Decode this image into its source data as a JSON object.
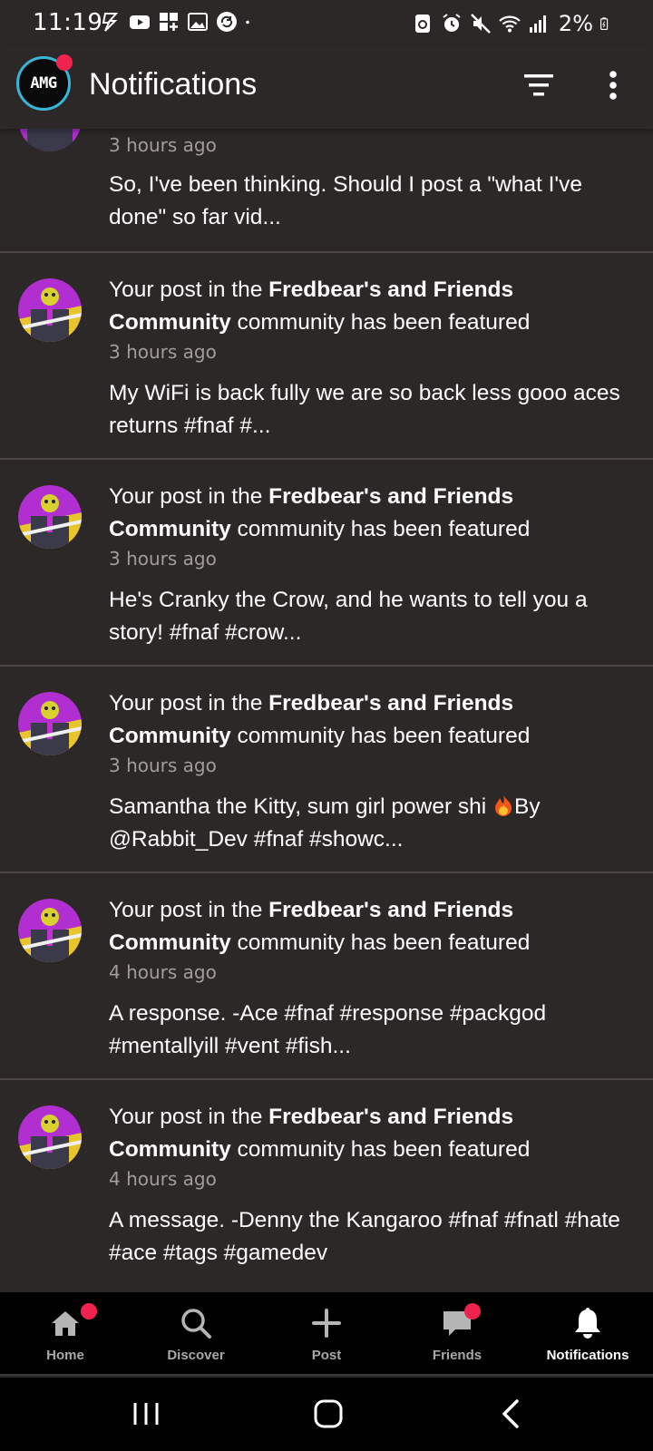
{
  "status_bar": {
    "time": "11:19",
    "battery": "2%",
    "left_icons": [
      "flash-icon",
      "youtube-icon",
      "apps-icon",
      "gallery-icon",
      "sync-icon",
      "dot-icon"
    ],
    "right_icons": [
      "recycle-icon",
      "alarm-icon",
      "mute-icon",
      "wifi-icon",
      "signal-icon",
      "battery-icon"
    ]
  },
  "header": {
    "logo_text": "AMG",
    "title": "Notifications",
    "filter_icon": "filter-icon",
    "more_icon": "more-vert-icon"
  },
  "notifications": [
    {
      "head_prefix": "",
      "community": "",
      "head_suffix": "",
      "time": "3 hours ago",
      "body": "So, I've been thinking. Should I post a \"what I've done\" so far vid..."
    },
    {
      "head_prefix": "Your post in the ",
      "community": "Fredbear's and Friends Community",
      "head_suffix": " community has been featured",
      "time": "3 hours ago",
      "body": "My WiFi is back fully we are so back less gooo aces returns #fnaf #..."
    },
    {
      "head_prefix": "Your post in the ",
      "community": "Fredbear's and Friends Community",
      "head_suffix": " community has been featured",
      "time": "3 hours ago",
      "body": "He's Cranky the Crow, and he wants to tell you a story! #fnaf #crow..."
    },
    {
      "head_prefix": "Your post in the ",
      "community": "Fredbear's and Friends Community",
      "head_suffix": " community has been featured",
      "time": "3 hours ago",
      "body_before": "Samantha the Kitty, sum girl power shi ",
      "body_after": "By @Rabbit_Dev #fnaf #showc..."
    },
    {
      "head_prefix": "Your post in the ",
      "community": "Fredbear's and Friends Community",
      "head_suffix": " community has been featured",
      "time": "4 hours ago",
      "body": "A response. -Ace #fnaf #response #packgod #mentallyill #vent #fish..."
    },
    {
      "head_prefix": "Your post in the ",
      "community": "Fredbear's and Friends Community",
      "head_suffix": " community has been featured",
      "time": "4 hours ago",
      "body": "A message. -Denny the Kangaroo #fnaf #fnatl #hate #ace #tags #gamedev"
    }
  ],
  "bottom_nav": [
    {
      "label": "Home",
      "icon": "home-icon",
      "badge": true,
      "active": false
    },
    {
      "label": "Discover",
      "icon": "search-icon",
      "badge": false,
      "active": false
    },
    {
      "label": "Post",
      "icon": "plus-icon",
      "badge": false,
      "active": false
    },
    {
      "label": "Friends",
      "icon": "chat-icon",
      "badge": true,
      "active": false
    },
    {
      "label": "Notifications",
      "icon": "bell-icon",
      "badge": false,
      "active": true
    }
  ],
  "system_nav": [
    "recents-icon",
    "home-circle-icon",
    "back-icon"
  ],
  "colors": {
    "background": "#2c2828",
    "badge": "#f0234f",
    "time_text": "#a29c9c",
    "divider": "#4d4747"
  }
}
